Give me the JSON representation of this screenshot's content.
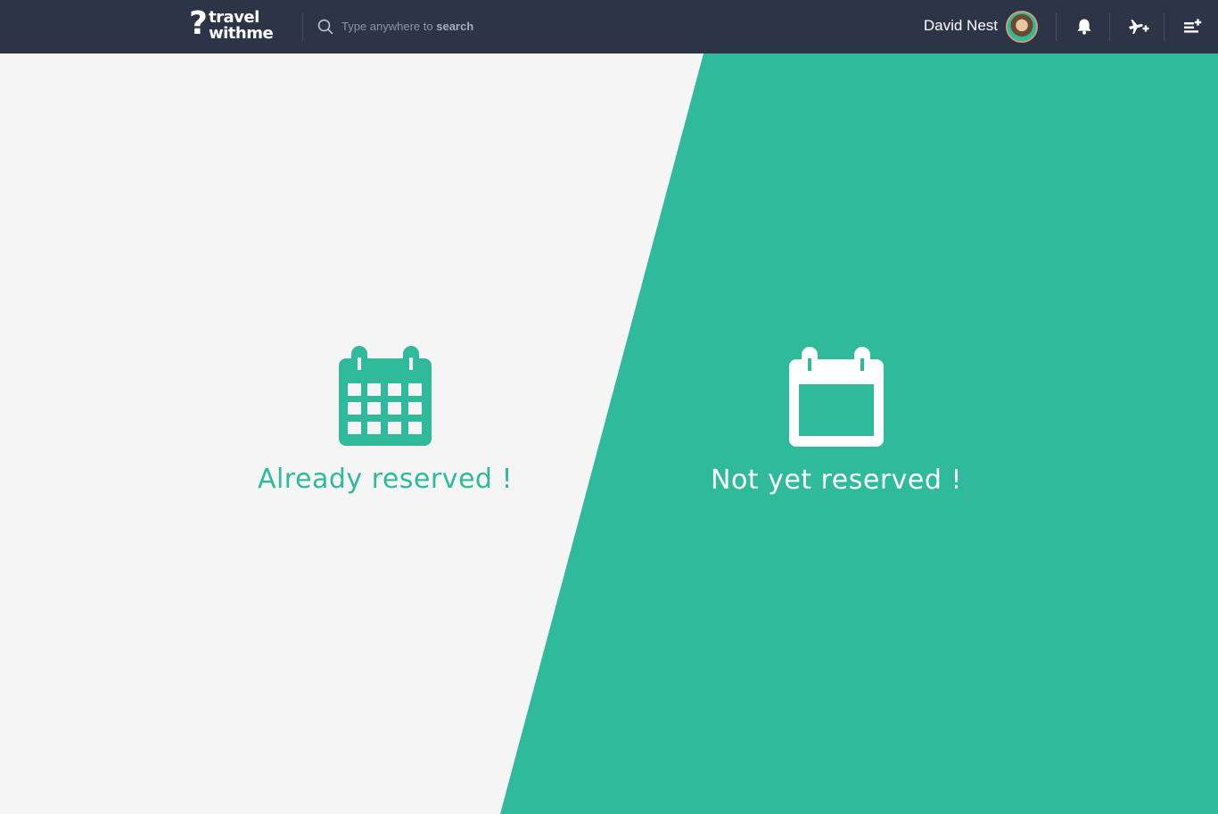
{
  "header": {
    "logo": {
      "line1": "travel",
      "line2": "withme",
      "mark": "?"
    },
    "search": {
      "placeholder_plain": "Type anywhere to ",
      "placeholder_bold": "search"
    },
    "user": {
      "name": "David Nest",
      "avatar_icon": "avatar-photo"
    },
    "icons": [
      "bell-icon",
      "plane-add-icon",
      "playlist-add-icon"
    ]
  },
  "panels": {
    "left": {
      "label": "Already reserved !",
      "icon": "calendar-grid-icon"
    },
    "right": {
      "label": "Not yet reserved !",
      "icon": "calendar-empty-icon"
    }
  },
  "colors": {
    "topbar": "#2e3447",
    "accent": "#2eba9b",
    "background": "#f5f5f5",
    "white": "#ffffff"
  }
}
